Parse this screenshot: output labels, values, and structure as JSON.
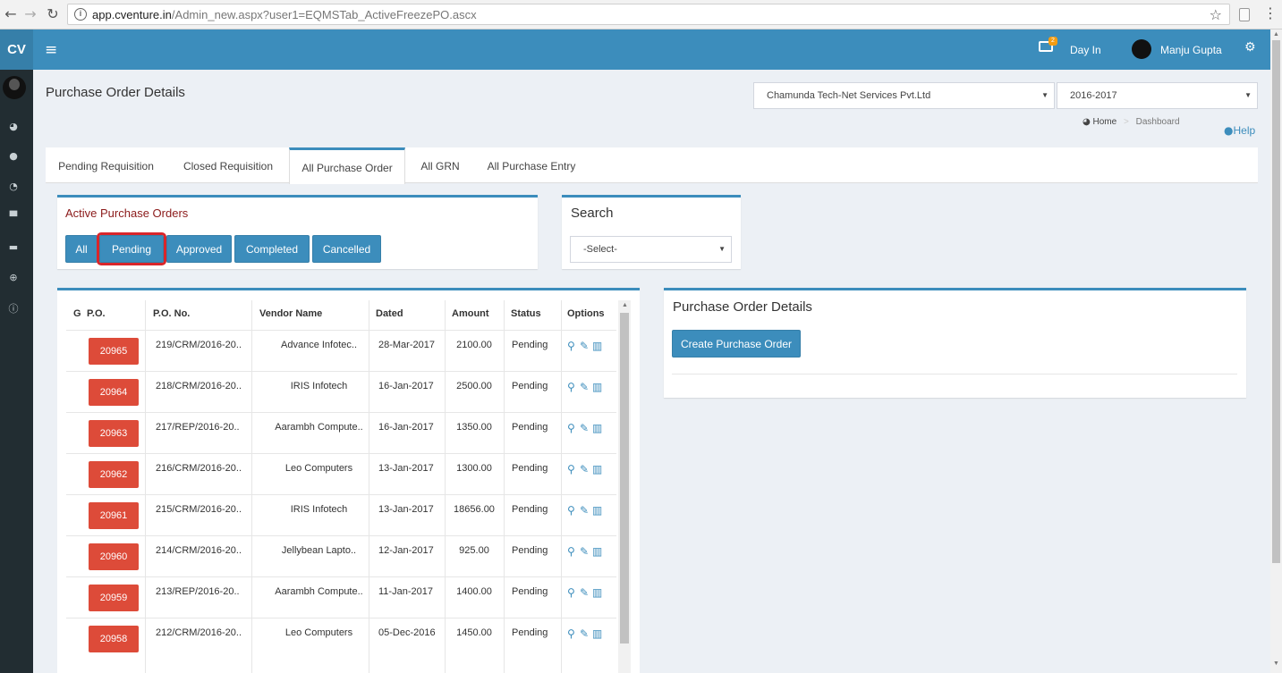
{
  "browser": {
    "url_host": "app.cventure.in",
    "url_path": "/Admin_new.aspx?user1=EQMSTab_ActiveFreezePO.ascx"
  },
  "sidebar": {
    "logo": "CV",
    "icons": [
      "dashboard-icon",
      "user-icon",
      "pie-chart-icon",
      "cart-icon",
      "credit-card-icon",
      "globe-icon",
      "info-icon"
    ]
  },
  "header": {
    "notification_count": "2",
    "day_in": "Day In",
    "user_name": "Manju Gupta"
  },
  "page": {
    "title": "Purchase Order Details",
    "company_select": "Chamunda Tech-Net Services Pvt.Ltd",
    "year_select": "2016-2017",
    "breadcrumb_home": "Home",
    "breadcrumb_current": "Dashboard",
    "help": "Help"
  },
  "tabs": [
    {
      "label": "Pending Requisition"
    },
    {
      "label": "Closed Requisition"
    },
    {
      "label": "All Purchase Order",
      "active": true
    },
    {
      "label": "All GRN"
    },
    {
      "label": "All Purchase Entry"
    }
  ],
  "filters": {
    "title": "Active Purchase Orders",
    "buttons": [
      "All",
      "Pending",
      "Approved",
      "Completed",
      "Cancelled"
    ],
    "selected": "Pending"
  },
  "search": {
    "title": "Search",
    "select_value": "-Select-"
  },
  "table": {
    "columns": [
      "G",
      "P.O.",
      "P.O. No.",
      "Vendor Name",
      "Dated",
      "Amount",
      "Status",
      "Options"
    ],
    "rows": [
      {
        "po": "20965",
        "po_no": "219/CRM/2016-20..",
        "vendor": "Advance Infotec..",
        "dated": "28-Mar-2017",
        "amount": "2100.00",
        "status": "Pending"
      },
      {
        "po": "20964",
        "po_no": "218/CRM/2016-20..",
        "vendor": "IRIS Infotech",
        "dated": "16-Jan-2017",
        "amount": "2500.00",
        "status": "Pending"
      },
      {
        "po": "20963",
        "po_no": "217/REP/2016-20..",
        "vendor": "Aarambh Compute..",
        "dated": "16-Jan-2017",
        "amount": "1350.00",
        "status": "Pending"
      },
      {
        "po": "20962",
        "po_no": "216/CRM/2016-20..",
        "vendor": "Leo Computers",
        "dated": "13-Jan-2017",
        "amount": "1300.00",
        "status": "Pending"
      },
      {
        "po": "20961",
        "po_no": "215/CRM/2016-20..",
        "vendor": "IRIS Infotech",
        "dated": "13-Jan-2017",
        "amount": "18656.00",
        "status": "Pending"
      },
      {
        "po": "20960",
        "po_no": "214/CRM/2016-20..",
        "vendor": "Jellybean Lapto..",
        "dated": "12-Jan-2017",
        "amount": "925.00",
        "status": "Pending"
      },
      {
        "po": "20959",
        "po_no": "213/REP/2016-20..",
        "vendor": "Aarambh Compute..",
        "dated": "11-Jan-2017",
        "amount": "1400.00",
        "status": "Pending"
      },
      {
        "po": "20958",
        "po_no": "212/CRM/2016-20..",
        "vendor": "Leo Computers",
        "dated": "05-Dec-2016",
        "amount": "1450.00",
        "status": "Pending"
      }
    ]
  },
  "details": {
    "title": "Purchase Order Details",
    "create_button": "Create Purchase Order"
  }
}
